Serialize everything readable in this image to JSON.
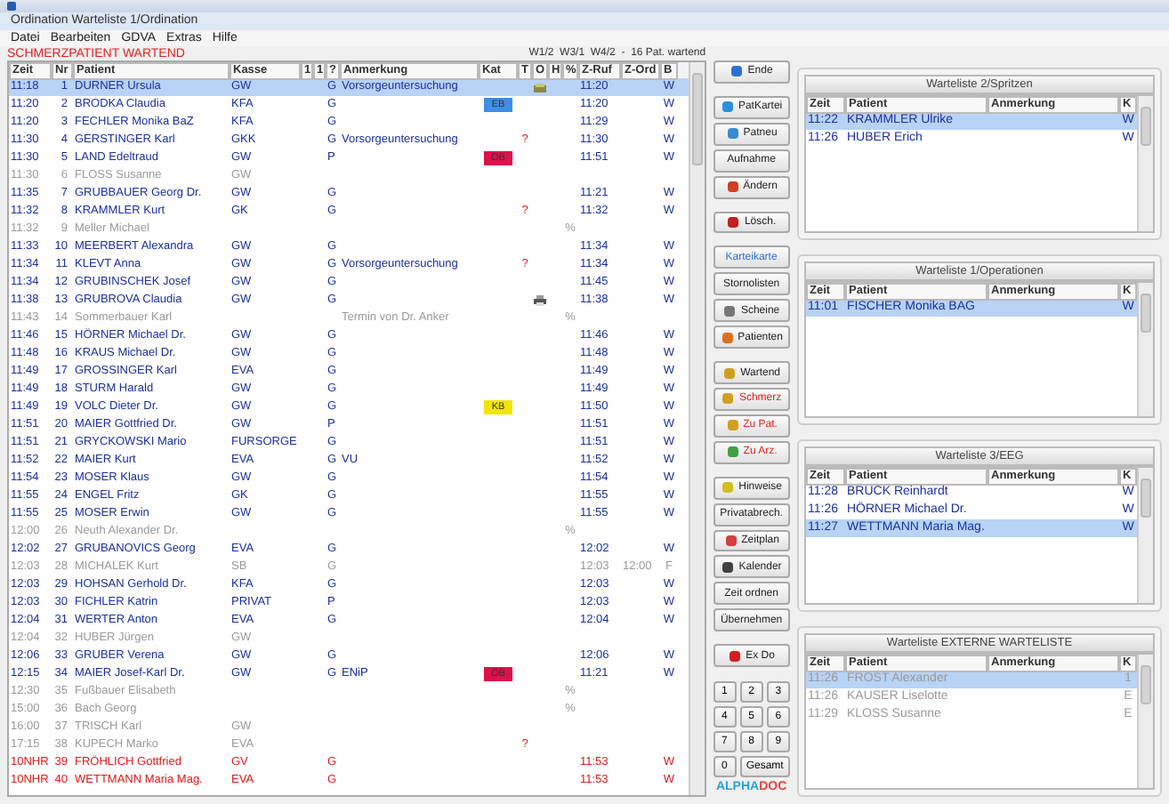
{
  "window": {
    "title": "Ordination Warteliste 1/Ordination"
  },
  "menu": [
    "Datei",
    "Bearbeiten",
    "GDVA",
    "Extras",
    "Hilfe"
  ],
  "alert_label": "SCHMERZPATIENT WARTEND",
  "summary": "W1/2  W3/1  W4/2  -  16 Pat. wartend",
  "table": {
    "columns": [
      "Zeit",
      "Nr",
      "Patient",
      "Kasse",
      "1",
      "1",
      "?",
      "Anmerkung",
      "Kat",
      "T",
      "O",
      "H",
      "%",
      "Z-Ruf",
      "Z-Ord",
      "B"
    ],
    "rows": [
      {
        "zeit": "11:18",
        "nr": "1",
        "patient": "DURNER Ursula",
        "kasse": "GW",
        "g": "G",
        "anmerkung": "Vorsorgeuntersuchung",
        "zruf": "11:20",
        "b": "W",
        "disabled": false,
        "urgent": false,
        "selected": true
      },
      {
        "zeit": "11:20",
        "nr": "2",
        "patient": "BRODKA Claudia",
        "kasse": "KFA",
        "g": "G",
        "kat": {
          "label": "EB",
          "color": "#3d8ee8"
        },
        "zruf": "11:20",
        "b": "W",
        "disabled": false,
        "urgent": false,
        "selected": false
      },
      {
        "zeit": "11:20",
        "nr": "3",
        "patient": "FECHLER Monika BaZ",
        "kasse": "KFA",
        "g": "G",
        "zruf": "11:29",
        "b": "W",
        "disabled": false,
        "urgent": false,
        "selected": false
      },
      {
        "zeit": "11:30",
        "nr": "4",
        "patient": "GERSTINGER Karl",
        "kasse": "GKK",
        "g": "G",
        "anmerkung": "Vorsorgeuntersuchung",
        "t": "?",
        "zruf": "11:30",
        "b": "W",
        "disabled": false,
        "urgent": false,
        "selected": false
      },
      {
        "zeit": "11:30",
        "nr": "5",
        "patient": "LAND Edeltraud",
        "kasse": "GW",
        "g": "P",
        "kat": {
          "label": "OB",
          "color": "#e0104a"
        },
        "zruf": "11:51",
        "b": "W",
        "disabled": false,
        "urgent": false,
        "selected": false
      },
      {
        "zeit": "11:30",
        "nr": "6",
        "patient": "FLOSS Susanne",
        "kasse": "GW",
        "disabled": true,
        "urgent": false,
        "selected": false
      },
      {
        "zeit": "11:35",
        "nr": "7",
        "patient": "GRUBBAUER Georg Dr.",
        "kasse": "GW",
        "g": "G",
        "zruf": "11:21",
        "b": "W",
        "disabled": false,
        "urgent": false,
        "selected": false
      },
      {
        "zeit": "11:32",
        "nr": "8",
        "patient": "KRAMMLER Kurt",
        "kasse": "GK",
        "g": "G",
        "t": "?",
        "zruf": "11:32",
        "b": "W",
        "disabled": false,
        "urgent": false,
        "selected": false
      },
      {
        "zeit": "11:32",
        "nr": "9",
        "patient": "Meller Michael",
        "pct": "%",
        "disabled": true,
        "urgent": false,
        "selected": false
      },
      {
        "zeit": "11:33",
        "nr": "10",
        "patient": "MEERBERT Alexandra",
        "kasse": "GW",
        "g": "G",
        "zruf": "11:34",
        "b": "W",
        "disabled": false,
        "urgent": false,
        "selected": false
      },
      {
        "zeit": "11:34",
        "nr": "11",
        "patient": "KLEVT Anna",
        "kasse": "GW",
        "g": "G",
        "anmerkung": "Vorsorgeuntersuchung",
        "t": "?",
        "zruf": "11:34",
        "b": "W",
        "disabled": false,
        "urgent": false,
        "selected": false
      },
      {
        "zeit": "11:34",
        "nr": "12",
        "patient": "GRUBINSCHEK Josef",
        "kasse": "GW",
        "g": "G",
        "zruf": "11:45",
        "b": "W",
        "disabled": false,
        "urgent": false,
        "selected": false
      },
      {
        "zeit": "11:38",
        "nr": "13",
        "patient": "GRUBROVA Claudia",
        "kasse": "GW",
        "g": "G",
        "zruf": "11:38",
        "b": "W",
        "disabled": false,
        "urgent": false,
        "selected": false
      },
      {
        "zeit": "11:43",
        "nr": "14",
        "patient": "Sommerbauer Karl",
        "anmerkung": "Termin von Dr. Anker",
        "pct": "%",
        "disabled": true,
        "urgent": false,
        "selected": false
      },
      {
        "zeit": "11:46",
        "nr": "15",
        "patient": "HÖRNER Michael Dr.",
        "kasse": "GW",
        "g": "G",
        "zruf": "11:46",
        "b": "W",
        "disabled": false,
        "urgent": false,
        "selected": false
      },
      {
        "zeit": "11:48",
        "nr": "16",
        "patient": "KRAUS Michael Dr.",
        "kasse": "GW",
        "g": "G",
        "zruf": "11:48",
        "b": "W",
        "disabled": false,
        "urgent": false,
        "selected": false
      },
      {
        "zeit": "11:49",
        "nr": "17",
        "patient": "GROSSINGER Karl",
        "kasse": "EVA",
        "g": "G",
        "zruf": "11:49",
        "b": "W",
        "disabled": false,
        "urgent": false,
        "selected": false
      },
      {
        "zeit": "11:49",
        "nr": "18",
        "patient": "STURM Harald",
        "kasse": "GW",
        "g": "G",
        "zruf": "11:49",
        "b": "W",
        "disabled": false,
        "urgent": false,
        "selected": false
      },
      {
        "zeit": "11:49",
        "nr": "19",
        "patient": "VOLC Dieter Dr.",
        "kasse": "GW",
        "g": "G",
        "kat": {
          "label": "KB",
          "color": "#f2e40a"
        },
        "zruf": "11:50",
        "b": "W",
        "disabled": false,
        "urgent": false,
        "selected": false
      },
      {
        "zeit": "11:51",
        "nr": "20",
        "patient": "MAIER Gottfried Dr.",
        "kasse": "GW",
        "g": "P",
        "zruf": "11:51",
        "b": "W",
        "disabled": false,
        "urgent": false,
        "selected": false
      },
      {
        "zeit": "11:51",
        "nr": "21",
        "patient": "GRYCKOWSKI Mario",
        "kasse": "FURSORGE",
        "g": "G",
        "zruf": "11:51",
        "b": "W",
        "disabled": false,
        "urgent": false,
        "selected": false
      },
      {
        "zeit": "11:52",
        "nr": "22",
        "patient": "MAIER Kurt",
        "kasse": "EVA",
        "g": "G",
        "anmerkung": "VU",
        "zruf": "11:52",
        "b": "W",
        "disabled": false,
        "urgent": false,
        "selected": false
      },
      {
        "zeit": "11:54",
        "nr": "23",
        "patient": "MOSER Klaus",
        "kasse": "GW",
        "g": "G",
        "zruf": "11:54",
        "b": "W",
        "disabled": false,
        "urgent": false,
        "selected": false
      },
      {
        "zeit": "11:55",
        "nr": "24",
        "patient": "ENGEL Fritz",
        "kasse": "GK",
        "g": "G",
        "zruf": "11:55",
        "b": "W",
        "disabled": false,
        "urgent": false,
        "selected": false
      },
      {
        "zeit": "11:55",
        "nr": "25",
        "patient": "MOSER Erwin",
        "kasse": "GW",
        "g": "G",
        "zruf": "11:55",
        "b": "W",
        "disabled": false,
        "urgent": false,
        "selected": false
      },
      {
        "zeit": "12:00",
        "nr": "26",
        "patient": "Neuth Alexander Dr.",
        "pct": "%",
        "disabled": true,
        "urgent": false,
        "selected": false
      },
      {
        "zeit": "12:02",
        "nr": "27",
        "patient": "GRUBANOVICS Georg",
        "kasse": "EVA",
        "g": "G",
        "zruf": "12:02",
        "b": "W",
        "disabled": false,
        "urgent": false,
        "selected": false
      },
      {
        "zeit": "12:03",
        "nr": "28",
        "patient": "MICHALEK Kurt",
        "kasse": "SB",
        "g": "G",
        "zruf": "12:03",
        "zord": "12:00",
        "b": "F",
        "disabled": true,
        "urgent": false,
        "selected": false
      },
      {
        "zeit": "12:03",
        "nr": "29",
        "patient": "HOHSAN Gerhold Dr.",
        "kasse": "KFA",
        "g": "G",
        "zruf": "12:03",
        "b": "W",
        "disabled": false,
        "urgent": false,
        "selected": false
      },
      {
        "zeit": "12:03",
        "nr": "30",
        "patient": "FICHLER Katrin",
        "kasse": "PRIVAT",
        "g": "P",
        "zruf": "12:03",
        "b": "W",
        "disabled": false,
        "urgent": false,
        "selected": false
      },
      {
        "zeit": "12:04",
        "nr": "31",
        "patient": "WERTER Anton",
        "kasse": "EVA",
        "g": "G",
        "zruf": "12:04",
        "b": "W",
        "disabled": false,
        "urgent": false,
        "selected": false
      },
      {
        "zeit": "12:04",
        "nr": "32",
        "patient": "HUBER Jürgen",
        "kasse": "GW",
        "disabled": true,
        "urgent": false,
        "selected": false
      },
      {
        "zeit": "12:06",
        "nr": "33",
        "patient": "GRUBER Verena",
        "kasse": "GW",
        "g": "G",
        "zruf": "12:06",
        "b": "W",
        "disabled": false,
        "urgent": false,
        "selected": false
      },
      {
        "zeit": "12:15",
        "nr": "34",
        "patient": "MAIER Josef-Karl Dr.",
        "kasse": "GW",
        "g": "G",
        "anmerkung": "ENiP",
        "kat": {
          "label": "OB",
          "color": "#e0104a"
        },
        "zruf": "11:21",
        "b": "W",
        "disabled": false,
        "urgent": false,
        "selected": false
      },
      {
        "zeit": "12:30",
        "nr": "35",
        "patient": "Fußbauer Elisabeth",
        "pct": "%",
        "disabled": true,
        "urgent": false,
        "selected": false
      },
      {
        "zeit": "15:00",
        "nr": "36",
        "patient": "Bach Georg",
        "pct": "%",
        "disabled": true,
        "urgent": false,
        "selected": false
      },
      {
        "zeit": "16:00",
        "nr": "37",
        "patient": "TRISCH Karl",
        "kasse": "GW",
        "disabled": true,
        "urgent": false,
        "selected": false
      },
      {
        "zeit": "17:15",
        "nr": "38",
        "patient": "KUPECH Marko",
        "kasse": "EVA",
        "t": "?",
        "disabled": true,
        "urgent": false,
        "selected": false
      },
      {
        "zeit": "10NHR",
        "nr": "39",
        "patient": "FRÖHLICH Gottfried",
        "kasse": "GV",
        "g": "G",
        "zruf": "11:53",
        "b": "W",
        "disabled": false,
        "urgent": true,
        "selected": false
      },
      {
        "zeit": "10NHR",
        "nr": "40",
        "patient": "WETTMANN Maria Mag.",
        "kasse": "EVA",
        "g": "G",
        "zruf": "11:53",
        "b": "W",
        "disabled": false,
        "urgent": true,
        "selected": false
      }
    ]
  },
  "button_groups": [
    [
      {
        "label": "Ende",
        "kind": "normal"
      }
    ],
    [
      {
        "label": "PatKartei",
        "kind": "normal"
      },
      {
        "label": "Patneu",
        "kind": "normal"
      },
      {
        "label": "Aufnahme",
        "kind": "normal"
      },
      {
        "label": "Ändern",
        "kind": "normal"
      }
    ],
    [
      {
        "label": "Lösch.",
        "kind": "normal"
      }
    ],
    [
      {
        "label": "Karteikarte",
        "kind": "link"
      },
      {
        "label": "Stornolisten",
        "kind": "normal"
      },
      {
        "label": "Scheine",
        "kind": "normal"
      },
      {
        "label": "Patienten",
        "kind": "normal"
      }
    ],
    [
      {
        "label": "Wartend",
        "kind": "normal"
      },
      {
        "label": "Schmerz",
        "kind": "alert"
      },
      {
        "label": "Zu Pat.",
        "kind": "alert"
      },
      {
        "label": "Zu Arz.",
        "kind": "alert"
      }
    ],
    [
      {
        "label": "Hinweise",
        "kind": "normal"
      },
      {
        "label": "Privatabrech.",
        "kind": "normal"
      },
      {
        "label": "Zeitplan",
        "kind": "normal"
      },
      {
        "label": "Kalender",
        "kind": "normal"
      },
      {
        "label": "Zeit ordnen",
        "kind": "normal"
      },
      {
        "label": "Übernehmen",
        "kind": "normal"
      }
    ],
    [
      {
        "label": "Ex Do",
        "kind": "normal"
      }
    ]
  ],
  "keypad": [
    "1",
    "2",
    "3",
    "4",
    "5",
    "6",
    "7",
    "8",
    "9",
    "0",
    "Gesamt"
  ],
  "logo": {
    "part1": "ALPHA",
    "part2": "DOC"
  },
  "panels": [
    {
      "title": "Warteliste 2/Spritzen",
      "columns": [
        "Zeit",
        "Patient",
        "Anmerkung",
        "K"
      ],
      "rows": [
        {
          "zeit": "11:22",
          "patient": "KRAMMLER Ulrike",
          "b": "W",
          "disabled": false,
          "selected": true
        },
        {
          "zeit": "11:26",
          "patient": "HUBER Erich",
          "b": "W",
          "disabled": false,
          "selected": false
        }
      ]
    },
    {
      "title": "Warteliste 1/Operationen",
      "columns": [
        "Zeit",
        "Patient",
        "Anmerkung",
        "K"
      ],
      "rows": [
        {
          "zeit": "11:01",
          "patient": "FISCHER Monika BAG",
          "b": "W",
          "disabled": false,
          "selected": true
        }
      ]
    },
    {
      "title": "Warteliste 3/EEG",
      "columns": [
        "Zeit",
        "Patient",
        "Anmerkung",
        "K"
      ],
      "rows": [
        {
          "zeit": "11:28",
          "patient": "BRUCK Reinhardt",
          "b": "W",
          "disabled": false,
          "selected": false
        },
        {
          "zeit": "11:26",
          "patient": "HÖRNER Michael Dr.",
          "b": "W",
          "disabled": false,
          "selected": false
        },
        {
          "zeit": "11:27",
          "patient": "WETTMANN Maria Mag.",
          "b": "W",
          "disabled": false,
          "selected": true
        }
      ]
    },
    {
      "title": "Warteliste EXTERNE WARTELISTE",
      "columns": [
        "Zeit",
        "Patient",
        "Anmerkung",
        "K"
      ],
      "rows": [
        {
          "zeit": "11:26",
          "patient": "FROST Alexander",
          "b": "1",
          "disabled": true,
          "selected": true
        },
        {
          "zeit": "11:26",
          "patient": "KAUSER Liselotte",
          "b": "E",
          "disabled": true,
          "selected": false
        },
        {
          "zeit": "11:29",
          "patient": "KLOSS Susanne",
          "b": "E",
          "disabled": true,
          "selected": false
        }
      ]
    }
  ]
}
